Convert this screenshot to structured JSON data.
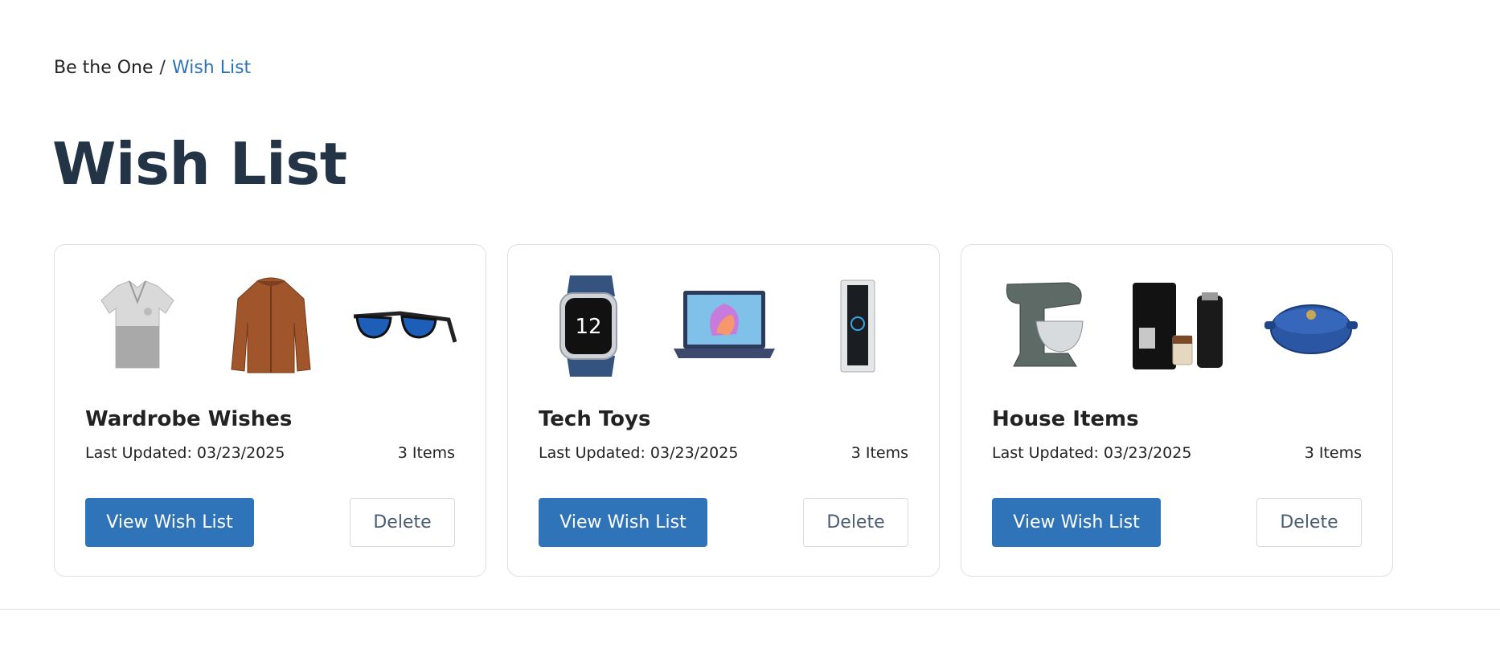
{
  "breadcrumb": {
    "home": "Be the One",
    "separator": "/",
    "current": "Wish List"
  },
  "page": {
    "title": "Wish List"
  },
  "cards": [
    {
      "title": "Wardrobe Wishes",
      "updated": "Last Updated: 03/23/2025",
      "count": "3 Items",
      "view_label": "View Wish List",
      "delete_label": "Delete",
      "thumbnails": [
        "polo-shirt-image",
        "brown-jacket-image",
        "sunglasses-image"
      ]
    },
    {
      "title": "Tech Toys",
      "updated": "Last Updated: 03/23/2025",
      "count": "3 Items",
      "view_label": "View Wish List",
      "delete_label": "Delete",
      "thumbnails": [
        "smartwatch-image",
        "laptop-image",
        "video-doorbell-image"
      ]
    },
    {
      "title": "House Items",
      "updated": "Last Updated: 03/23/2025",
      "count": "3 Items",
      "view_label": "View Wish List",
      "delete_label": "Delete",
      "thumbnails": [
        "stand-mixer-image",
        "espresso-machine-image",
        "dutch-oven-image"
      ]
    }
  ],
  "colors": {
    "accent": "#2f73b8",
    "title": "#233447",
    "border": "#dcdfe3"
  }
}
